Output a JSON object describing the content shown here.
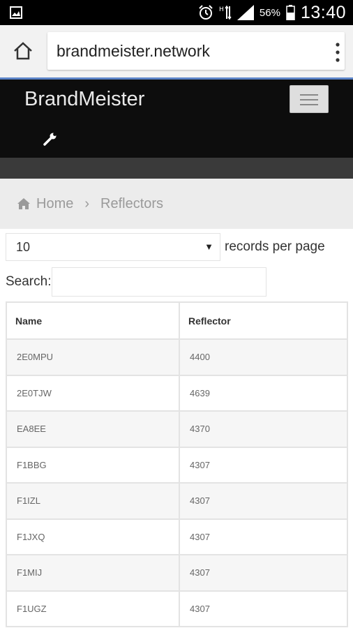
{
  "status_bar": {
    "battery": "56%",
    "time": "13:40",
    "icons": [
      "gallery-icon",
      "alarm-icon",
      "data-arrows-icon",
      "signal-icon",
      "battery-icon"
    ]
  },
  "browser": {
    "url": "brandmeister.network",
    "icons": [
      "home-icon",
      "overflow-menu-icon"
    ]
  },
  "navbar": {
    "brand": "BrandMeister",
    "icons": [
      "menu-toggle-icon",
      "wrench-icon"
    ]
  },
  "breadcrumb": {
    "home": "Home",
    "separator": "›",
    "current": "Reflectors"
  },
  "table_controls": {
    "page_length": "10",
    "records_label": "records per page",
    "search_label": "Search:",
    "search_value": ""
  },
  "table": {
    "columns": [
      "Name",
      "Reflector"
    ],
    "rows": [
      [
        "2E0MPU",
        "4400"
      ],
      [
        "2E0TJW",
        "4639"
      ],
      [
        "EA8EE",
        "4370"
      ],
      [
        "F1BBG",
        "4307"
      ],
      [
        "F1IZL",
        "4307"
      ],
      [
        "F1JXQ",
        "4307"
      ],
      [
        "F1MIJ",
        "4307"
      ],
      [
        "F1UGZ",
        "4307"
      ]
    ]
  },
  "colors": {
    "navbar_bg": "#0d0d0d",
    "url_underline": "#5c84c8",
    "breadcrumb_bg": "#ececec"
  }
}
